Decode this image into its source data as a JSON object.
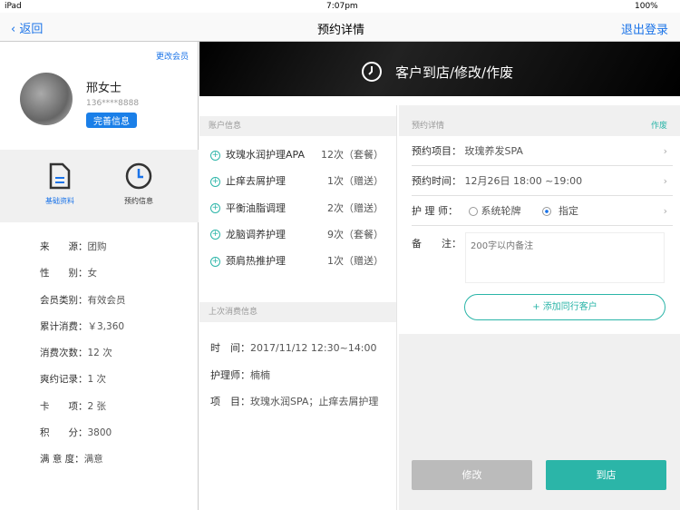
{
  "status": {
    "device": "iPad",
    "time": "7:07pm",
    "battery": "100%"
  },
  "nav": {
    "back": "返回",
    "title": "预约详情",
    "logout": "退出登录"
  },
  "profile": {
    "change_member": "更改会员",
    "name": "邢女士",
    "phone": "136****8888",
    "complete": "完善信息"
  },
  "tabs": [
    {
      "label": "基础资料"
    },
    {
      "label": "预约信息"
    }
  ],
  "fields": [
    {
      "label": "来　　源：",
      "value": "团购"
    },
    {
      "label": "性　　别：",
      "value": "女"
    },
    {
      "label": "会员类别：",
      "value": "有效会员"
    },
    {
      "label": "累计消费：",
      "value": "￥3,360"
    },
    {
      "label": "消费次数：",
      "value": "12 次"
    },
    {
      "label": "爽约记录：",
      "value": "1 次"
    },
    {
      "label": "卡　　项：",
      "value": "2 张"
    },
    {
      "label": "积　　分：",
      "value": "3800"
    },
    {
      "label": "满 意 度：",
      "value": "满意"
    }
  ],
  "banner": {
    "title": "客户到店/修改/作废"
  },
  "account": {
    "header": "账户信息",
    "items": [
      {
        "name": "玫瑰水润护理APA",
        "count": "12次（套餐）"
      },
      {
        "name": "止痒去屑护理",
        "count": "1次（赠送）"
      },
      {
        "name": "平衡油脂调理",
        "count": "2次（赠送）"
      },
      {
        "name": "龙脑调养护理",
        "count": "9次（套餐）"
      },
      {
        "name": "颈肩热推护理",
        "count": "1次（赠送）"
      }
    ]
  },
  "last": {
    "header": "上次消费信息",
    "rows": [
      {
        "label": "时　间：",
        "value": "2017/11/12  12:30~14:00"
      },
      {
        "label": "护理师：",
        "value": "楠楠"
      },
      {
        "label": "项　目：",
        "value": "玫瑰水润SPA；止痒去屑护理"
      }
    ]
  },
  "detail": {
    "header": "预约详情",
    "void": "作废",
    "project_label": "预约项目：",
    "project": "玫瑰养发SPA",
    "time_label": "预约时间：",
    "time": "12月26日  18:00 ~19:00",
    "therapist_label": "护 理 师：",
    "opt1": "系统轮牌",
    "opt2": "指定",
    "note_label": "备　　注：",
    "note_placeholder": "200字以内备注",
    "add_companion": "+ 添加同行客户",
    "modify": "修改",
    "arrive": "到店"
  },
  "colors": {
    "accent": "#2bb5a8",
    "blue": "#1a73e8"
  }
}
